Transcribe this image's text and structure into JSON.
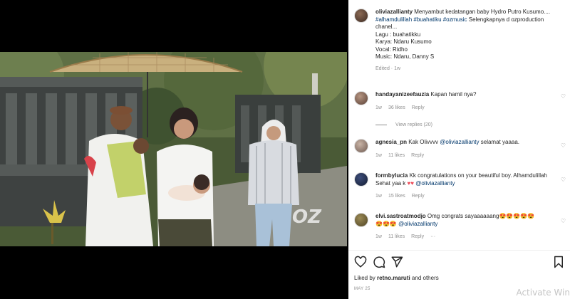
{
  "post": {
    "author": "oliviazallianty",
    "caption_text": "Menyambut kedatangan baby Hydro Putro Kusumo.... ",
    "caption_tags": "#alhamdulillah #buahatiku #ozmusic",
    "caption_cont": " Selengkapnya d ozproduction chanel...",
    "credits": [
      "Lagu : buahatikku",
      "Karya: Ndaru Kusumo",
      "Vocal: Ridho",
      "Music: Ndaru, Danny S"
    ],
    "edited": "Edited · 1w"
  },
  "comments": [
    {
      "user": "handayanizeefauzia",
      "text": "Kapan hamil nya?",
      "age": "1w",
      "likes": "36 likes",
      "reply": "Reply"
    },
    {
      "user": "agnesia_pn",
      "text": "Kak Olivvvv ",
      "mention": "@oliviazallianty",
      "text2": " selamat yaaaa.",
      "age": "1w",
      "likes": "11 likes",
      "reply": "Reply"
    },
    {
      "user": "formbylucia",
      "text": "Kk congratulations on your beautiful boy. Alhamdulillah Sehat yaa k ",
      "hearts": "♥♥",
      "mention": "@oliviazallianty",
      "age": "1w",
      "likes": "15 likes",
      "reply": "Reply"
    },
    {
      "user": "elvi.sastroatmodjo",
      "text": "Omg congrats sayaaaaaang",
      "emojis1": "😍😍😍😍😍",
      "emojis2": "😍😍😍",
      "mention": "@oliviazallianty",
      "age": "1w",
      "likes": "11 likes",
      "reply": "Reply",
      "more": "···"
    }
  ],
  "view_replies": "View replies (20)",
  "likes_line": {
    "prefix": "Liked by ",
    "user": "retno.maruti",
    "suffix": " and others"
  },
  "date": "MAY 25",
  "watermark": "Activate Win",
  "icons": [
    "heart-icon",
    "comment-icon",
    "share-icon",
    "bookmark-icon"
  ],
  "colors": {
    "link": "#00376b",
    "muted": "#8e8e8e",
    "heart": "#ed4956"
  }
}
